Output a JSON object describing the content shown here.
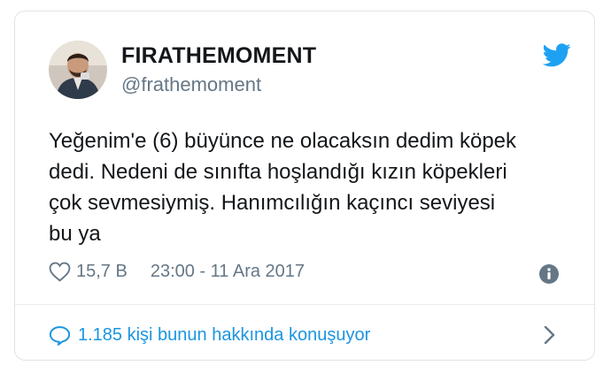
{
  "tweet": {
    "display_name": "FIRATHEMOMENT",
    "handle": "@frathemoment",
    "text_lines": [
      "Yeğenim'e (6) büyünce ne olacaksın dedim köpek",
      "dedi. Nedeni de sınıfta hoşlandığı kızın köpekleri",
      "çok sevmesiymiş. Hanımcılığın kaçıncı seviyesi",
      "bu ya"
    ],
    "likes": "15,7 B",
    "timestamp": "23:00 - 11 Ara 2017",
    "conversation": "1.185 kişi bunun hakkında konuşuyor"
  },
  "icons": {
    "brand": "twitter-bird-icon",
    "like": "heart-icon",
    "info": "info-icon",
    "reply": "speech-bubble-icon",
    "more": "chevron-right-icon"
  },
  "colors": {
    "brand_blue": "#1da1f2",
    "link_blue": "#1b95e0",
    "text": "#14171a",
    "secondary": "#657786",
    "border": "#dfe4e8"
  }
}
